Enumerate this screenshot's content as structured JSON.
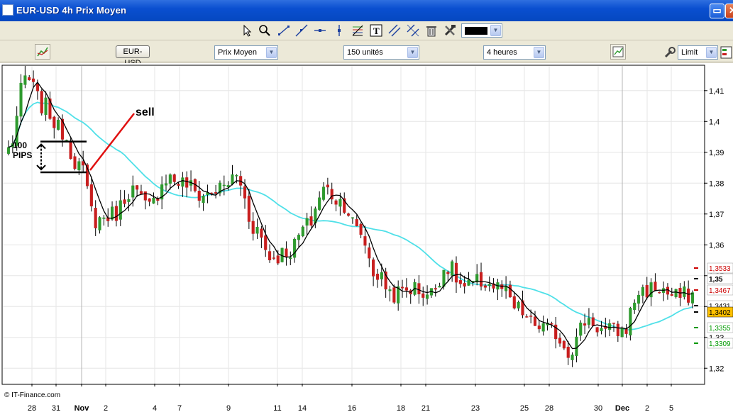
{
  "window": {
    "title": "EUR-USD 4h Prix Moyen",
    "icon": "chart-window-icon",
    "controls": [
      "minimize-icon",
      "close-icon"
    ]
  },
  "toolbar": {
    "icons": [
      "cursor-icon",
      "zoom-icon",
      "line-icon",
      "trendline-icon",
      "horizontal-line-icon",
      "vertical-line-icon",
      "fibonacci-icon",
      "text-icon",
      "channel-icon",
      "trash-icon",
      "tools-icon"
    ],
    "line_color": "#000000"
  },
  "controls": {
    "symbol": "EUR-USD",
    "price_type": "Prix Moyen",
    "units": "150 unités",
    "timeframe": "4 heures",
    "order_type": "Limit"
  },
  "chart_data": {
    "type": "candlestick",
    "instrument": "EUR-USD",
    "timeframe": "4h",
    "ylim": [
      1.315,
      1.418
    ],
    "y_ticks": [
      1.41,
      1.4,
      1.39,
      1.38,
      1.37,
      1.36,
      1.35,
      1.34,
      1.33,
      1.32
    ],
    "y_tick_labels": [
      "1,41",
      "1,4",
      "1,39",
      "1,38",
      "1,37",
      "1,36",
      "1,35",
      "1,34",
      "1,33",
      "1,32"
    ],
    "x_tick_labels": [
      "28",
      "31",
      "Nov",
      "2",
      "4",
      "7",
      "9",
      "11",
      "14",
      "16",
      "18",
      "21",
      "23",
      "25",
      "28",
      "30",
      "Dec",
      "2",
      "5"
    ],
    "grid": true,
    "price_labels": [
      {
        "text": "1,3533",
        "value": 1.3533,
        "color": "#cc0000"
      },
      {
        "text": "1,35",
        "value": 1.35,
        "color": "#000000"
      },
      {
        "text": "1,3467",
        "value": 1.3467,
        "color": "#cc0000"
      },
      {
        "text": "1,3431",
        "value": 1.3431,
        "color": "#000000"
      },
      {
        "text": "1,3402",
        "value": 1.3402,
        "color": "#000000",
        "bg": "#ffc000"
      },
      {
        "text": "1,3355",
        "value": 1.3355,
        "color": "#009900"
      },
      {
        "text": "1,3309",
        "value": 1.3309,
        "color": "#009900"
      }
    ],
    "anchor_closes": [
      1.391,
      1.414,
      1.405,
      1.397,
      1.386,
      1.368,
      1.37,
      1.378,
      1.372,
      1.382,
      1.38,
      1.376,
      1.378,
      1.382,
      1.366,
      1.356,
      1.358,
      1.366,
      1.378,
      1.374,
      1.364,
      1.35,
      1.344,
      1.346,
      1.344,
      1.353,
      1.346,
      1.348,
      1.346,
      1.339,
      1.334,
      1.332,
      1.326,
      1.336,
      1.332,
      1.332,
      1.345,
      1.346,
      1.343,
      1.344
    ],
    "series": [
      {
        "name": "close",
        "color_up": "#2e9a2e",
        "color_down": "#c81e1e"
      },
      {
        "name": "fast-ma",
        "color": "#000000"
      },
      {
        "name": "slow-ma",
        "color": "#4fe0e8"
      }
    ],
    "annotations": [
      {
        "text": "sell",
        "color": "#000000"
      },
      {
        "text": "100 PIPS",
        "color": "#000000"
      }
    ],
    "watermark": "© IT-Finance.com"
  }
}
